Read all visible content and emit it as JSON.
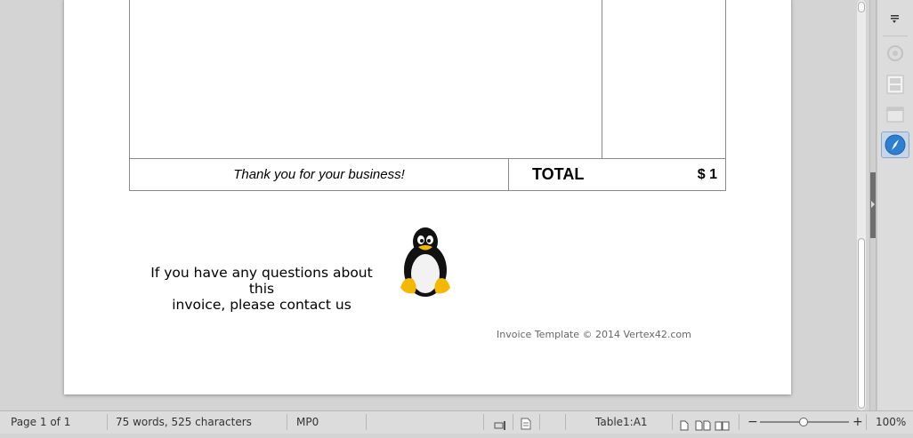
{
  "document": {
    "thanks_text": "Thank you for your business!",
    "total_label": "TOTAL",
    "total_value": "$ 1",
    "contact_line1": "If you have any questions about this",
    "contact_line2": "invoice, please contact us",
    "credit": "Invoice Template © 2014 Vertex42.com",
    "logo_icon": "tux-penguin-icon"
  },
  "sidebar": {
    "buttons": [
      {
        "icon": "sidebar-menu-icon"
      },
      {
        "icon": "navigator-icon",
        "disabled": true
      },
      {
        "icon": "page-icon",
        "disabled": true
      },
      {
        "icon": "gallery-icon",
        "disabled": true
      },
      {
        "icon": "compass-icon",
        "active": true
      }
    ]
  },
  "statusbar": {
    "page": "Page 1 of 1",
    "words": "75 words, 525 characters",
    "style": "MP0",
    "table_cell": "Table1:A1",
    "zoom": "100%",
    "zoom_minus": "−",
    "zoom_plus": "+"
  }
}
